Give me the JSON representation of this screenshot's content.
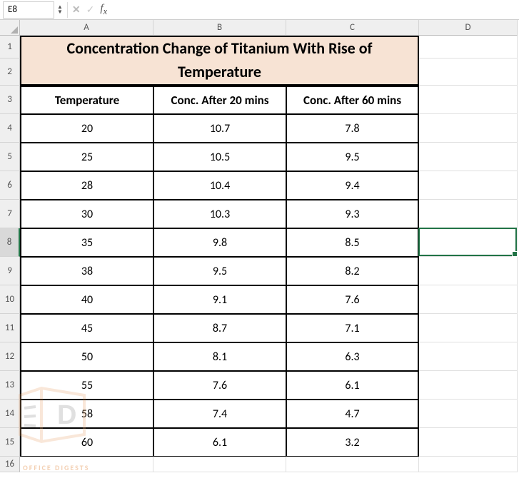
{
  "namebox": {
    "value": "E8"
  },
  "formula_bar": {
    "value": ""
  },
  "columns": [
    "A",
    "B",
    "C",
    "D"
  ],
  "row_numbers": [
    1,
    2,
    3,
    4,
    5,
    6,
    7,
    8,
    9,
    10,
    11,
    12,
    13,
    14,
    15,
    16
  ],
  "active_row": 8,
  "title": "Concentration Change of Titanium With Rise of Temperature",
  "title_line1": "Concentration Change of Titanium With Rise of",
  "title_line2": "Temperature",
  "headers": [
    "Temperature",
    "Conc. After 20 mins",
    "Conc. After 60 mins"
  ],
  "rows": [
    {
      "temp": "20",
      "c20": "10.7",
      "c60": "7.8"
    },
    {
      "temp": "25",
      "c20": "10.5",
      "c60": "9.5"
    },
    {
      "temp": "28",
      "c20": "10.4",
      "c60": "9.4"
    },
    {
      "temp": "30",
      "c20": "10.3",
      "c60": "9.3"
    },
    {
      "temp": "35",
      "c20": "9.8",
      "c60": "8.5"
    },
    {
      "temp": "38",
      "c20": "9.5",
      "c60": "8.2"
    },
    {
      "temp": "40",
      "c20": "9.1",
      "c60": "7.6"
    },
    {
      "temp": "45",
      "c20": "8.7",
      "c60": "7.1"
    },
    {
      "temp": "50",
      "c20": "8.1",
      "c60": "6.3"
    },
    {
      "temp": "55",
      "c20": "7.6",
      "c60": "6.1"
    },
    {
      "temp": "58",
      "c20": "7.4",
      "c60": "4.7"
    },
    {
      "temp": "60",
      "c20": "6.1",
      "c60": "3.2"
    }
  ],
  "watermark_letter": "D",
  "watermark_text": "OFFICE DIGESTS",
  "chart_data": {
    "type": "table",
    "title": "Concentration Change of Titanium With Rise of Temperature",
    "columns": [
      "Temperature",
      "Conc. After 20 mins",
      "Conc. After 60 mins"
    ],
    "data": [
      [
        20,
        10.7,
        7.8
      ],
      [
        25,
        10.5,
        9.5
      ],
      [
        28,
        10.4,
        9.4
      ],
      [
        30,
        10.3,
        9.3
      ],
      [
        35,
        9.8,
        8.5
      ],
      [
        38,
        9.5,
        8.2
      ],
      [
        40,
        9.1,
        7.6
      ],
      [
        45,
        8.7,
        7.1
      ],
      [
        50,
        8.1,
        6.3
      ],
      [
        55,
        7.6,
        6.1
      ],
      [
        58,
        7.4,
        4.7
      ],
      [
        60,
        6.1,
        3.2
      ]
    ]
  }
}
